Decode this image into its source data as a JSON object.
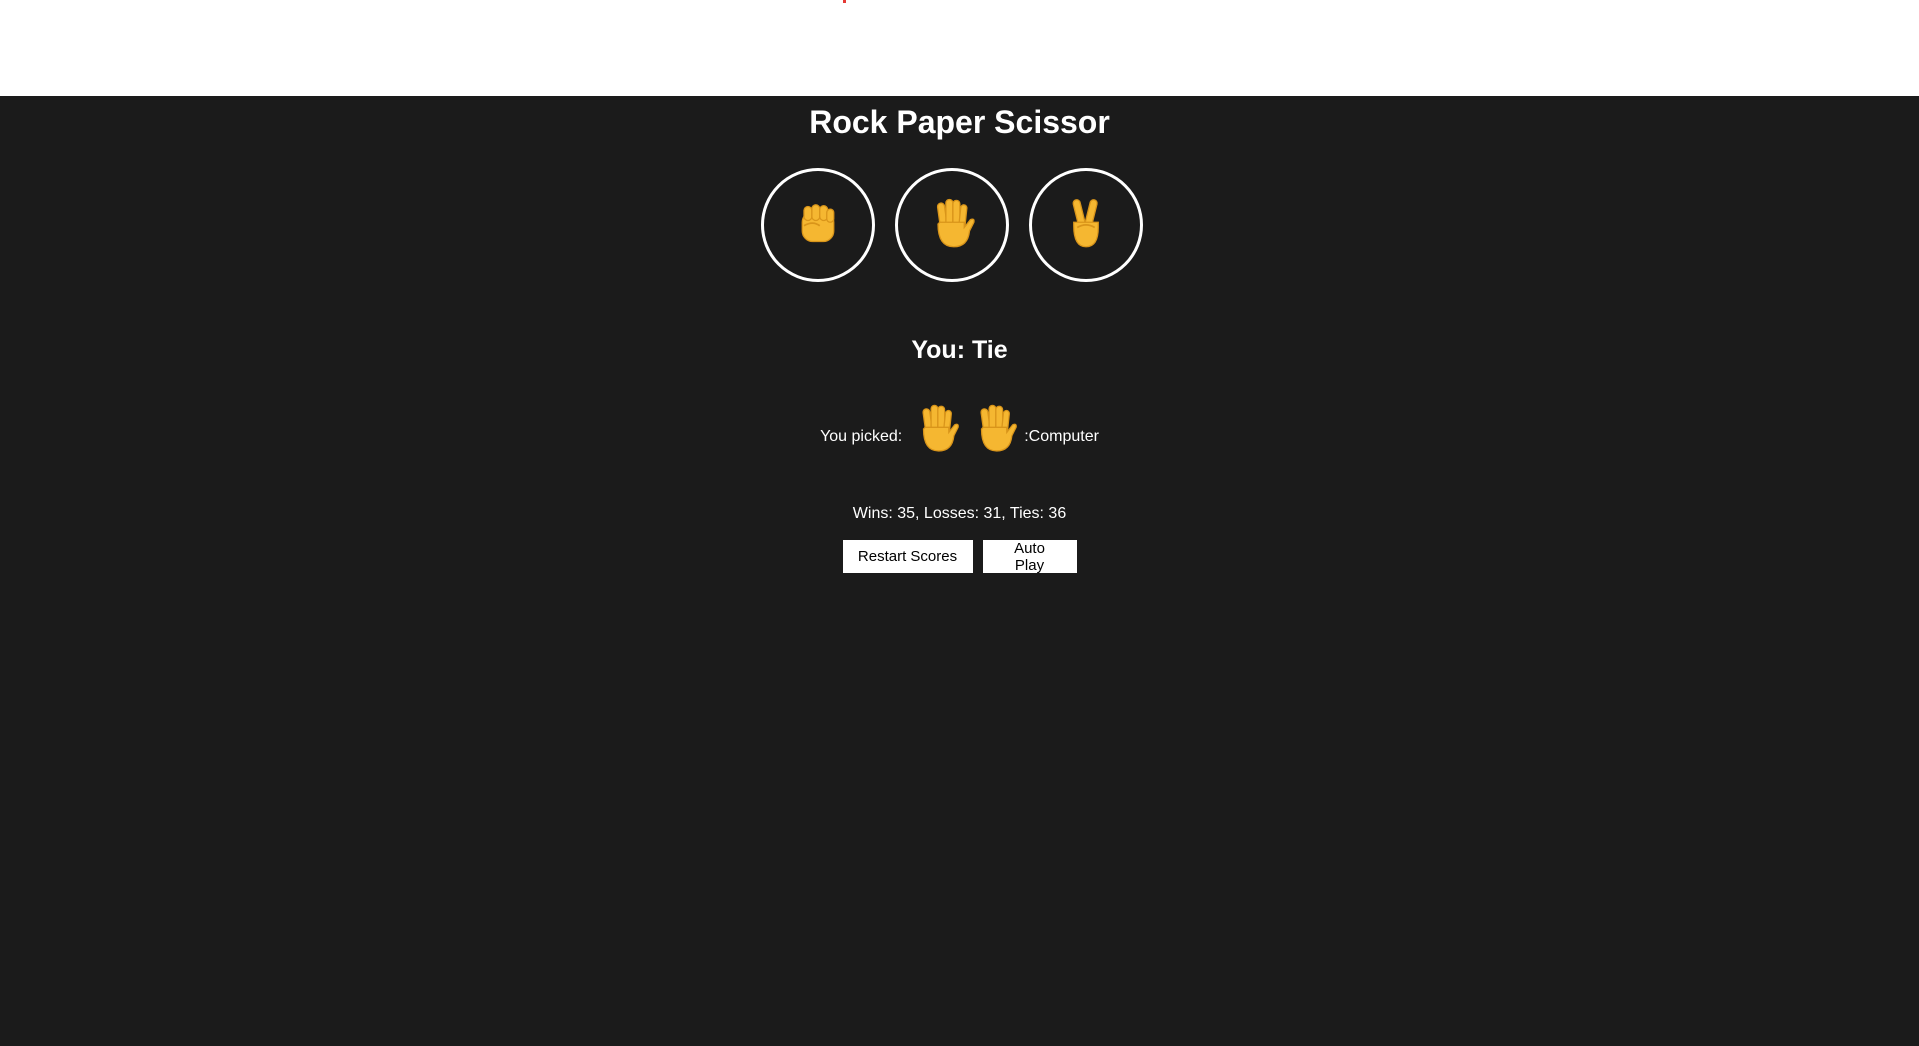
{
  "page": {
    "background_color": "#1b1b1b",
    "top_bar_color": "#ffffff"
  },
  "game": {
    "title": "Rock Paper Scissor",
    "moves": [
      {
        "name": "rock",
        "icon": "fist-icon"
      },
      {
        "name": "paper",
        "icon": "raised-hand-icon"
      },
      {
        "name": "scissors",
        "icon": "victory-hand-icon"
      }
    ],
    "result_text": "You: Tie",
    "you_picked_label": "You picked:",
    "computer_label": ":Computer",
    "player_move_icon": "raised-hand-icon",
    "computer_move_icon": "raised-hand-icon",
    "score_text": "Wins: 35, Losses: 31, Ties: 36",
    "restart_label": "Restart Scores",
    "autoplay_label": "Auto Play",
    "emoji_color": "#f5b731"
  }
}
